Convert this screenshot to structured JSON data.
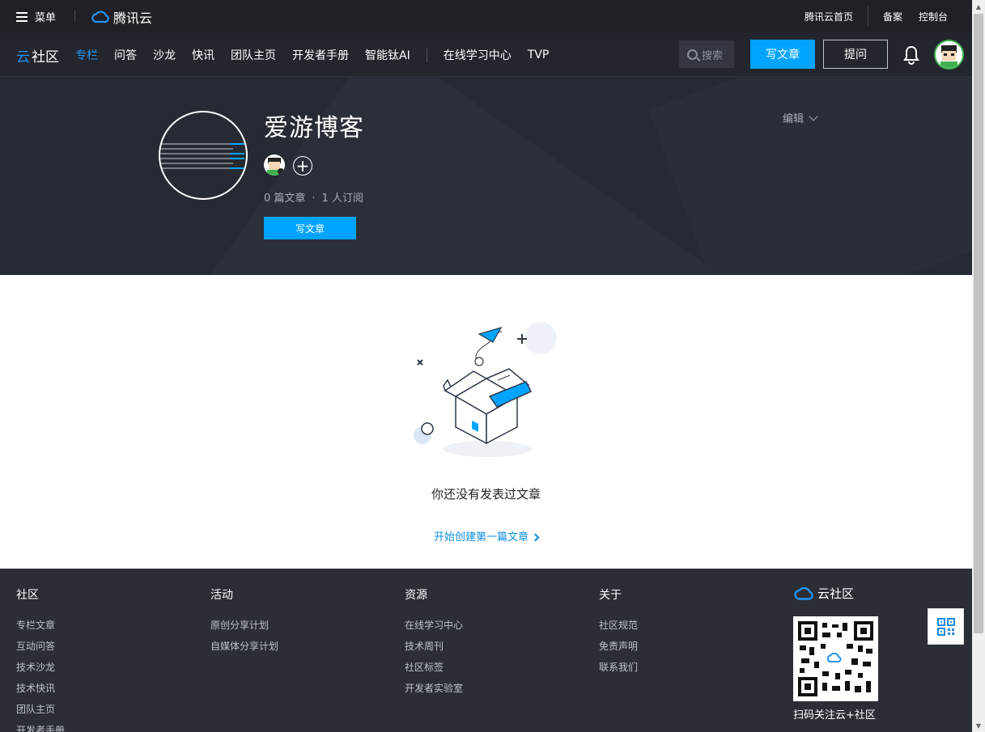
{
  "topbar": {
    "menu_label": "菜单",
    "brand": "腾讯云",
    "links": [
      "腾讯云首页",
      "备案",
      "控制台"
    ]
  },
  "navbar": {
    "logo": "社区",
    "items": [
      "专栏",
      "问答",
      "沙龙",
      "快讯",
      "团队主页",
      "开发者手册",
      "智能钛AI"
    ],
    "items2": [
      "在线学习中心",
      "TVP"
    ],
    "search_placeholder": "搜索",
    "write_label": "写文章",
    "ask_label": "提问",
    "accent": "#00a4ff"
  },
  "column": {
    "title": "爱游博客",
    "stats_articles": "0 篇文章",
    "stats_dot": "·",
    "stats_subscribers": "1 人订阅",
    "write_label": "写文章",
    "edit_label": "编辑"
  },
  "empty": {
    "message": "你还没有发表过文章",
    "link": "开始创建第一篇文章"
  },
  "footer": {
    "columns": [
      {
        "title": "社区",
        "links": [
          "专栏文章",
          "互动问答",
          "技术沙龙",
          "技术快讯",
          "团队主页",
          "开发者手册"
        ]
      },
      {
        "title": "活动",
        "links": [
          "原创分享计划",
          "自媒体分享计划"
        ]
      },
      {
        "title": "资源",
        "links": [
          "在线学习中心",
          "技术周刊",
          "社区标签",
          "开发者实验室"
        ]
      },
      {
        "title": "关于",
        "links": [
          "社区规范",
          "免责声明",
          "联系我们"
        ]
      }
    ],
    "brand": "云社区",
    "qr_caption": "扫码关注云+社区"
  }
}
